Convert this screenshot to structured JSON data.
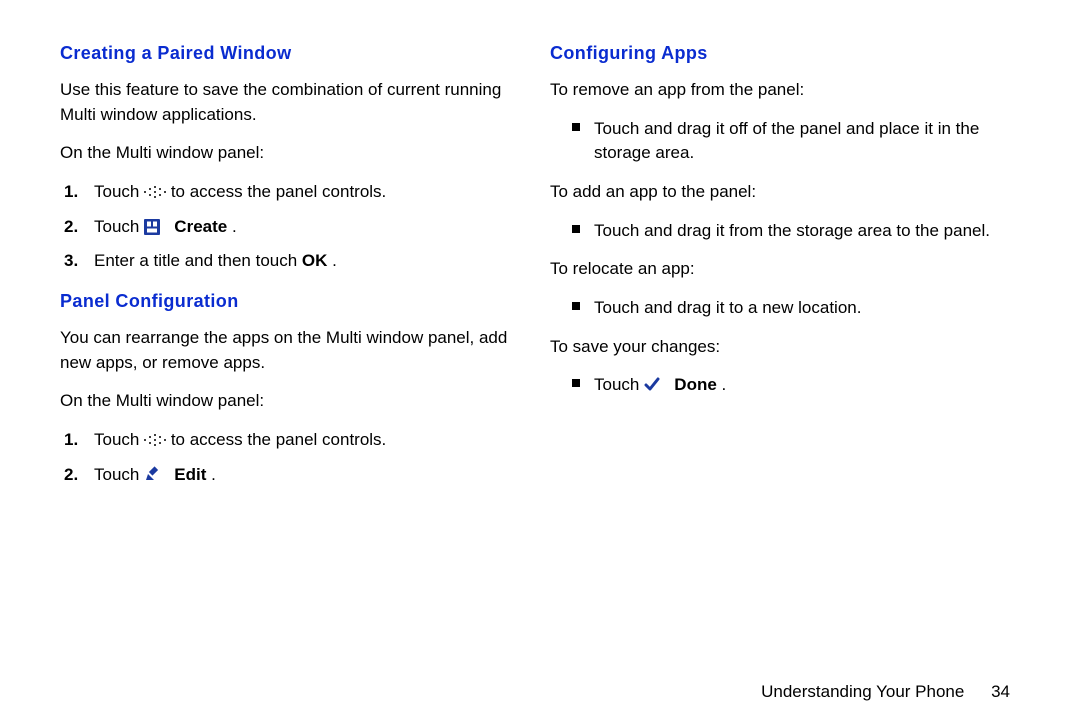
{
  "left": {
    "section1": {
      "heading": "Creating a Paired Window",
      "intro": "Use this feature to save the combination of current running Multi window applications.",
      "lead": "On the Multi window panel:",
      "steps": {
        "s1_a": "Touch ",
        "s1_b": " to access the panel controls.",
        "s2_a": "Touch ",
        "s2_b": "Create",
        "s2_c": ".",
        "s3_a": "Enter a title and then touch ",
        "s3_b": "OK",
        "s3_c": "."
      }
    },
    "section2": {
      "heading": "Panel Configuration",
      "intro": "You can rearrange the apps on the Multi window panel, add new apps, or remove apps.",
      "lead": "On the Multi window panel:",
      "steps": {
        "s1_a": "Touch ",
        "s1_b": " to access the panel controls.",
        "s2_a": "Touch ",
        "s2_b": "Edit",
        "s2_c": "."
      }
    }
  },
  "right": {
    "heading": "Configuring Apps",
    "remove_lead": "To remove an app from the panel:",
    "remove_bullet": "Touch and drag it off of the panel and place it in the storage area.",
    "add_lead": "To add an app to the panel:",
    "add_bullet": "Touch and drag it from the storage area to the panel.",
    "relocate_lead": "To relocate an app:",
    "relocate_bullet": "Touch and drag it to a new location.",
    "save_lead": "To save your changes:",
    "save_bullet_a": "Touch ",
    "save_bullet_b": "Done",
    "save_bullet_c": "."
  },
  "footer": {
    "section": "Understanding Your Phone",
    "page": "34"
  }
}
